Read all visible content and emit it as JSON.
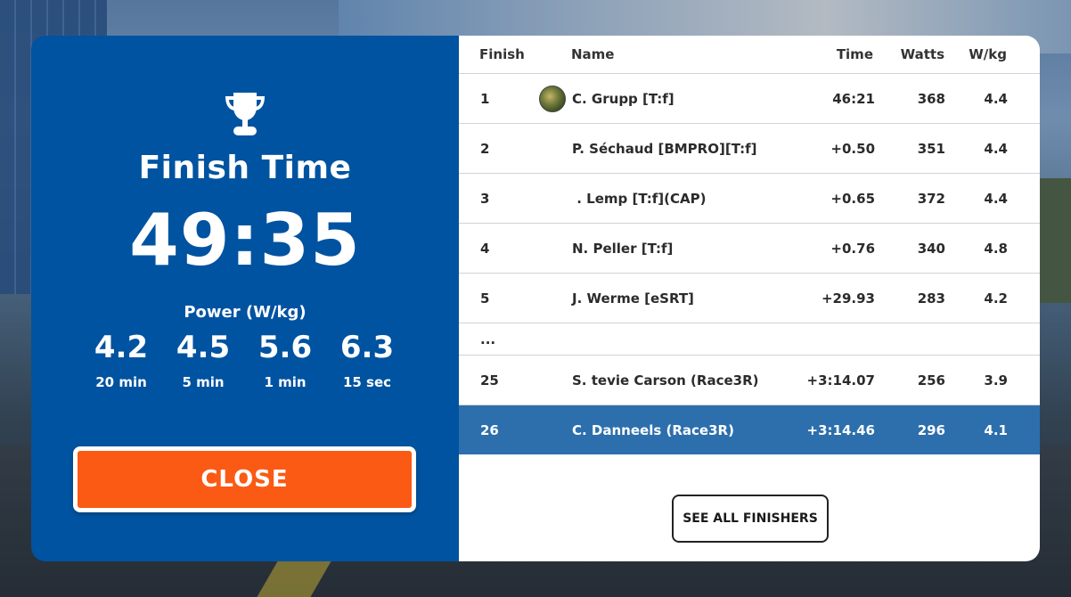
{
  "finish_panel": {
    "trophy_icon": "trophy-icon",
    "title": "Finish Time",
    "time": "49:35",
    "power_label": "Power (W/kg)",
    "stats": [
      {
        "value": "4.2",
        "label": "20 min"
      },
      {
        "value": "4.5",
        "label": "5 min"
      },
      {
        "value": "5.6",
        "label": "1 min"
      },
      {
        "value": "6.3",
        "label": "15 sec"
      }
    ],
    "close_label": "CLOSE"
  },
  "results": {
    "headers": {
      "finish": "Finish",
      "name": "Name",
      "time": "Time",
      "watts": "Watts",
      "wkg": "W/kg"
    },
    "rows": [
      {
        "finish": "1",
        "name": "C. Grupp [T:f]",
        "time": "46:21",
        "watts": "368",
        "wkg": "4.4",
        "avatar": true
      },
      {
        "finish": "2",
        "name": "P. Séchaud [BMPRO][T:f]",
        "time": "+0.50",
        "watts": "351",
        "wkg": "4.4"
      },
      {
        "finish": "3",
        "name": " . Lemp [T:f](CAP)",
        "time": "+0.65",
        "watts": "372",
        "wkg": "4.4"
      },
      {
        "finish": "4",
        "name": "N. Peller [T:f]",
        "time": "+0.76",
        "watts": "340",
        "wkg": "4.8"
      },
      {
        "finish": "5",
        "name": "J. Werme [eSRT]",
        "time": "+29.93",
        "watts": "283",
        "wkg": "4.2"
      }
    ],
    "ellipsis": "...",
    "bottom_rows": [
      {
        "finish": "25",
        "name": "S. tevie Carson (Race3R)",
        "time": "+3:14.07",
        "watts": "256",
        "wkg": "3.9"
      },
      {
        "finish": "26",
        "name": "C. Danneels (Race3R)",
        "time": "+3:14.46",
        "watts": "296",
        "wkg": "4.1",
        "highlighted": true
      }
    ],
    "see_all_label": "SEE ALL FINISHERS"
  },
  "colors": {
    "panel_blue": "#0053a1",
    "close_orange": "#fa5a14",
    "highlight_row": "#2d6fac"
  }
}
